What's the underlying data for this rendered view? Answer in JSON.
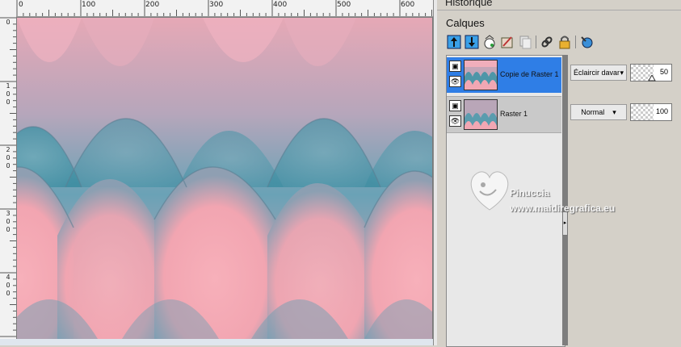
{
  "ruler": {
    "top_labels": [
      "0",
      "100",
      "200",
      "300",
      "400",
      "500",
      "600"
    ],
    "left_labels": [
      [
        "0"
      ],
      [
        "1",
        "0",
        "0"
      ],
      [
        "2",
        "0",
        "0"
      ],
      [
        "3",
        "0",
        "0"
      ],
      [
        "4",
        "0",
        "0"
      ]
    ]
  },
  "panels": {
    "history_title": "Historique",
    "layers_title": "Calques"
  },
  "toolbar": {
    "icons": [
      "new-raster-layer-icon",
      "new-vector-layer-icon",
      "new-mask-layer-icon",
      "adjustment-layer-icon",
      "duplicate-layer-icon",
      "link-layers-icon",
      "lock-transparency-icon",
      "layer-palette-options-icon"
    ]
  },
  "layers": [
    {
      "name": "Copie de Raster 1",
      "blend": "Éclaircir davantage",
      "opacity": "50",
      "selected": true
    },
    {
      "name": "Raster 1",
      "blend": "Normal",
      "opacity": "100",
      "selected": false
    }
  ],
  "watermark": {
    "name": "Pinuccia",
    "url": "www.maidiregrafica.eu"
  },
  "colors": {
    "pink": "#f3a7b3",
    "teal": "#4a97aa",
    "selection": "#2f7ee6"
  }
}
